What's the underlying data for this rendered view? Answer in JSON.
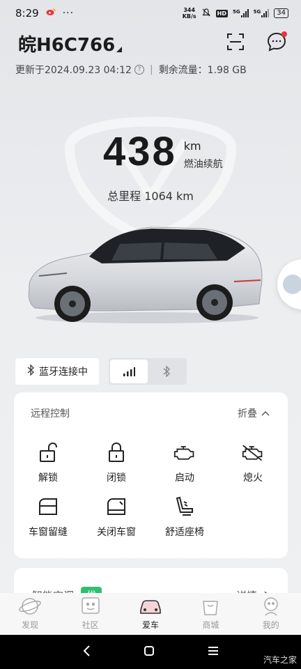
{
  "status_bar": {
    "time": "8:29",
    "notif_icons": [
      "weibo-icon",
      "more-dots-icon"
    ],
    "net_speed_value": "344",
    "net_speed_unit": "KB/s",
    "hd": "HD",
    "sig1": "5G",
    "sig2": "5G",
    "battery": "34"
  },
  "header": {
    "plate": "皖H6C766"
  },
  "update": {
    "text": "更新于2024.09.23 04:12",
    "separator": "|",
    "traffic": "剩余流量：1.98 GB"
  },
  "range": {
    "value": "438",
    "unit": "km",
    "label": "燃油续航"
  },
  "odometer": {
    "text": "总里程 1064 km"
  },
  "connection": {
    "bluetooth_status": "蓝牙连接中"
  },
  "remote": {
    "title": "远程控制",
    "fold_label": "折叠",
    "controls": [
      {
        "label": "解锁",
        "icon": "unlock-icon"
      },
      {
        "label": "闭锁",
        "icon": "lock-icon"
      },
      {
        "label": "启动",
        "icon": "engine-start-icon"
      },
      {
        "label": "熄火",
        "icon": "engine-off-icon"
      },
      {
        "label": "车窗留缝",
        "icon": "window-vent-icon"
      },
      {
        "label": "关闭车窗",
        "icon": "window-close-icon"
      },
      {
        "label": "舒适座椅",
        "icon": "seat-icon"
      }
    ]
  },
  "climate": {
    "title": "智能空调",
    "badge": "优",
    "details": "详情"
  },
  "tabs": [
    {
      "label": "发现",
      "icon": "planet-icon"
    },
    {
      "label": "社区",
      "icon": "community-icon"
    },
    {
      "label": "爱车",
      "icon": "car-icon"
    },
    {
      "label": "商城",
      "icon": "shop-bag-icon"
    },
    {
      "label": "我的",
      "icon": "profile-icon"
    }
  ],
  "watermark": "汽车之家",
  "colors": {
    "accent_red": "#e8343a",
    "badge_green": "#2fbf71"
  }
}
